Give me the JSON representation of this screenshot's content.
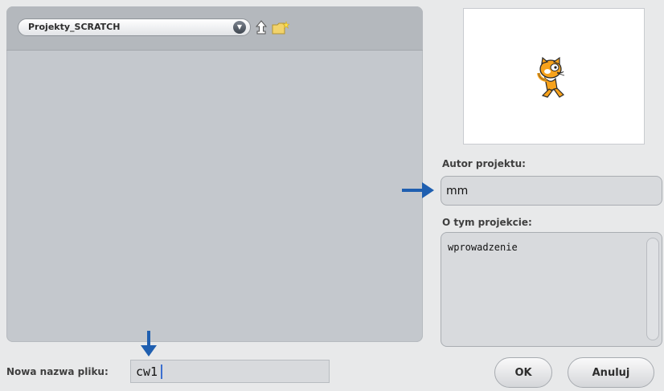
{
  "file_browser": {
    "folder": "Projekty_SCRATCH"
  },
  "author": {
    "label": "Autor projektu:",
    "value": "mm"
  },
  "about": {
    "label": "O tym projekcie:",
    "value": "wprowadzenie"
  },
  "filename": {
    "label": "Nowa nazwa pliku:",
    "value": "cw1"
  },
  "buttons": {
    "ok": "OK",
    "cancel": "Anuluj"
  },
  "icons": {
    "folder_dropdown": "dropdown-arrow-icon",
    "up": "folder-up-icon",
    "new_folder": "new-folder-icon",
    "annotation": "blue-arrow-icon"
  },
  "colors": {
    "accent_arrow": "#1f5fb0"
  }
}
